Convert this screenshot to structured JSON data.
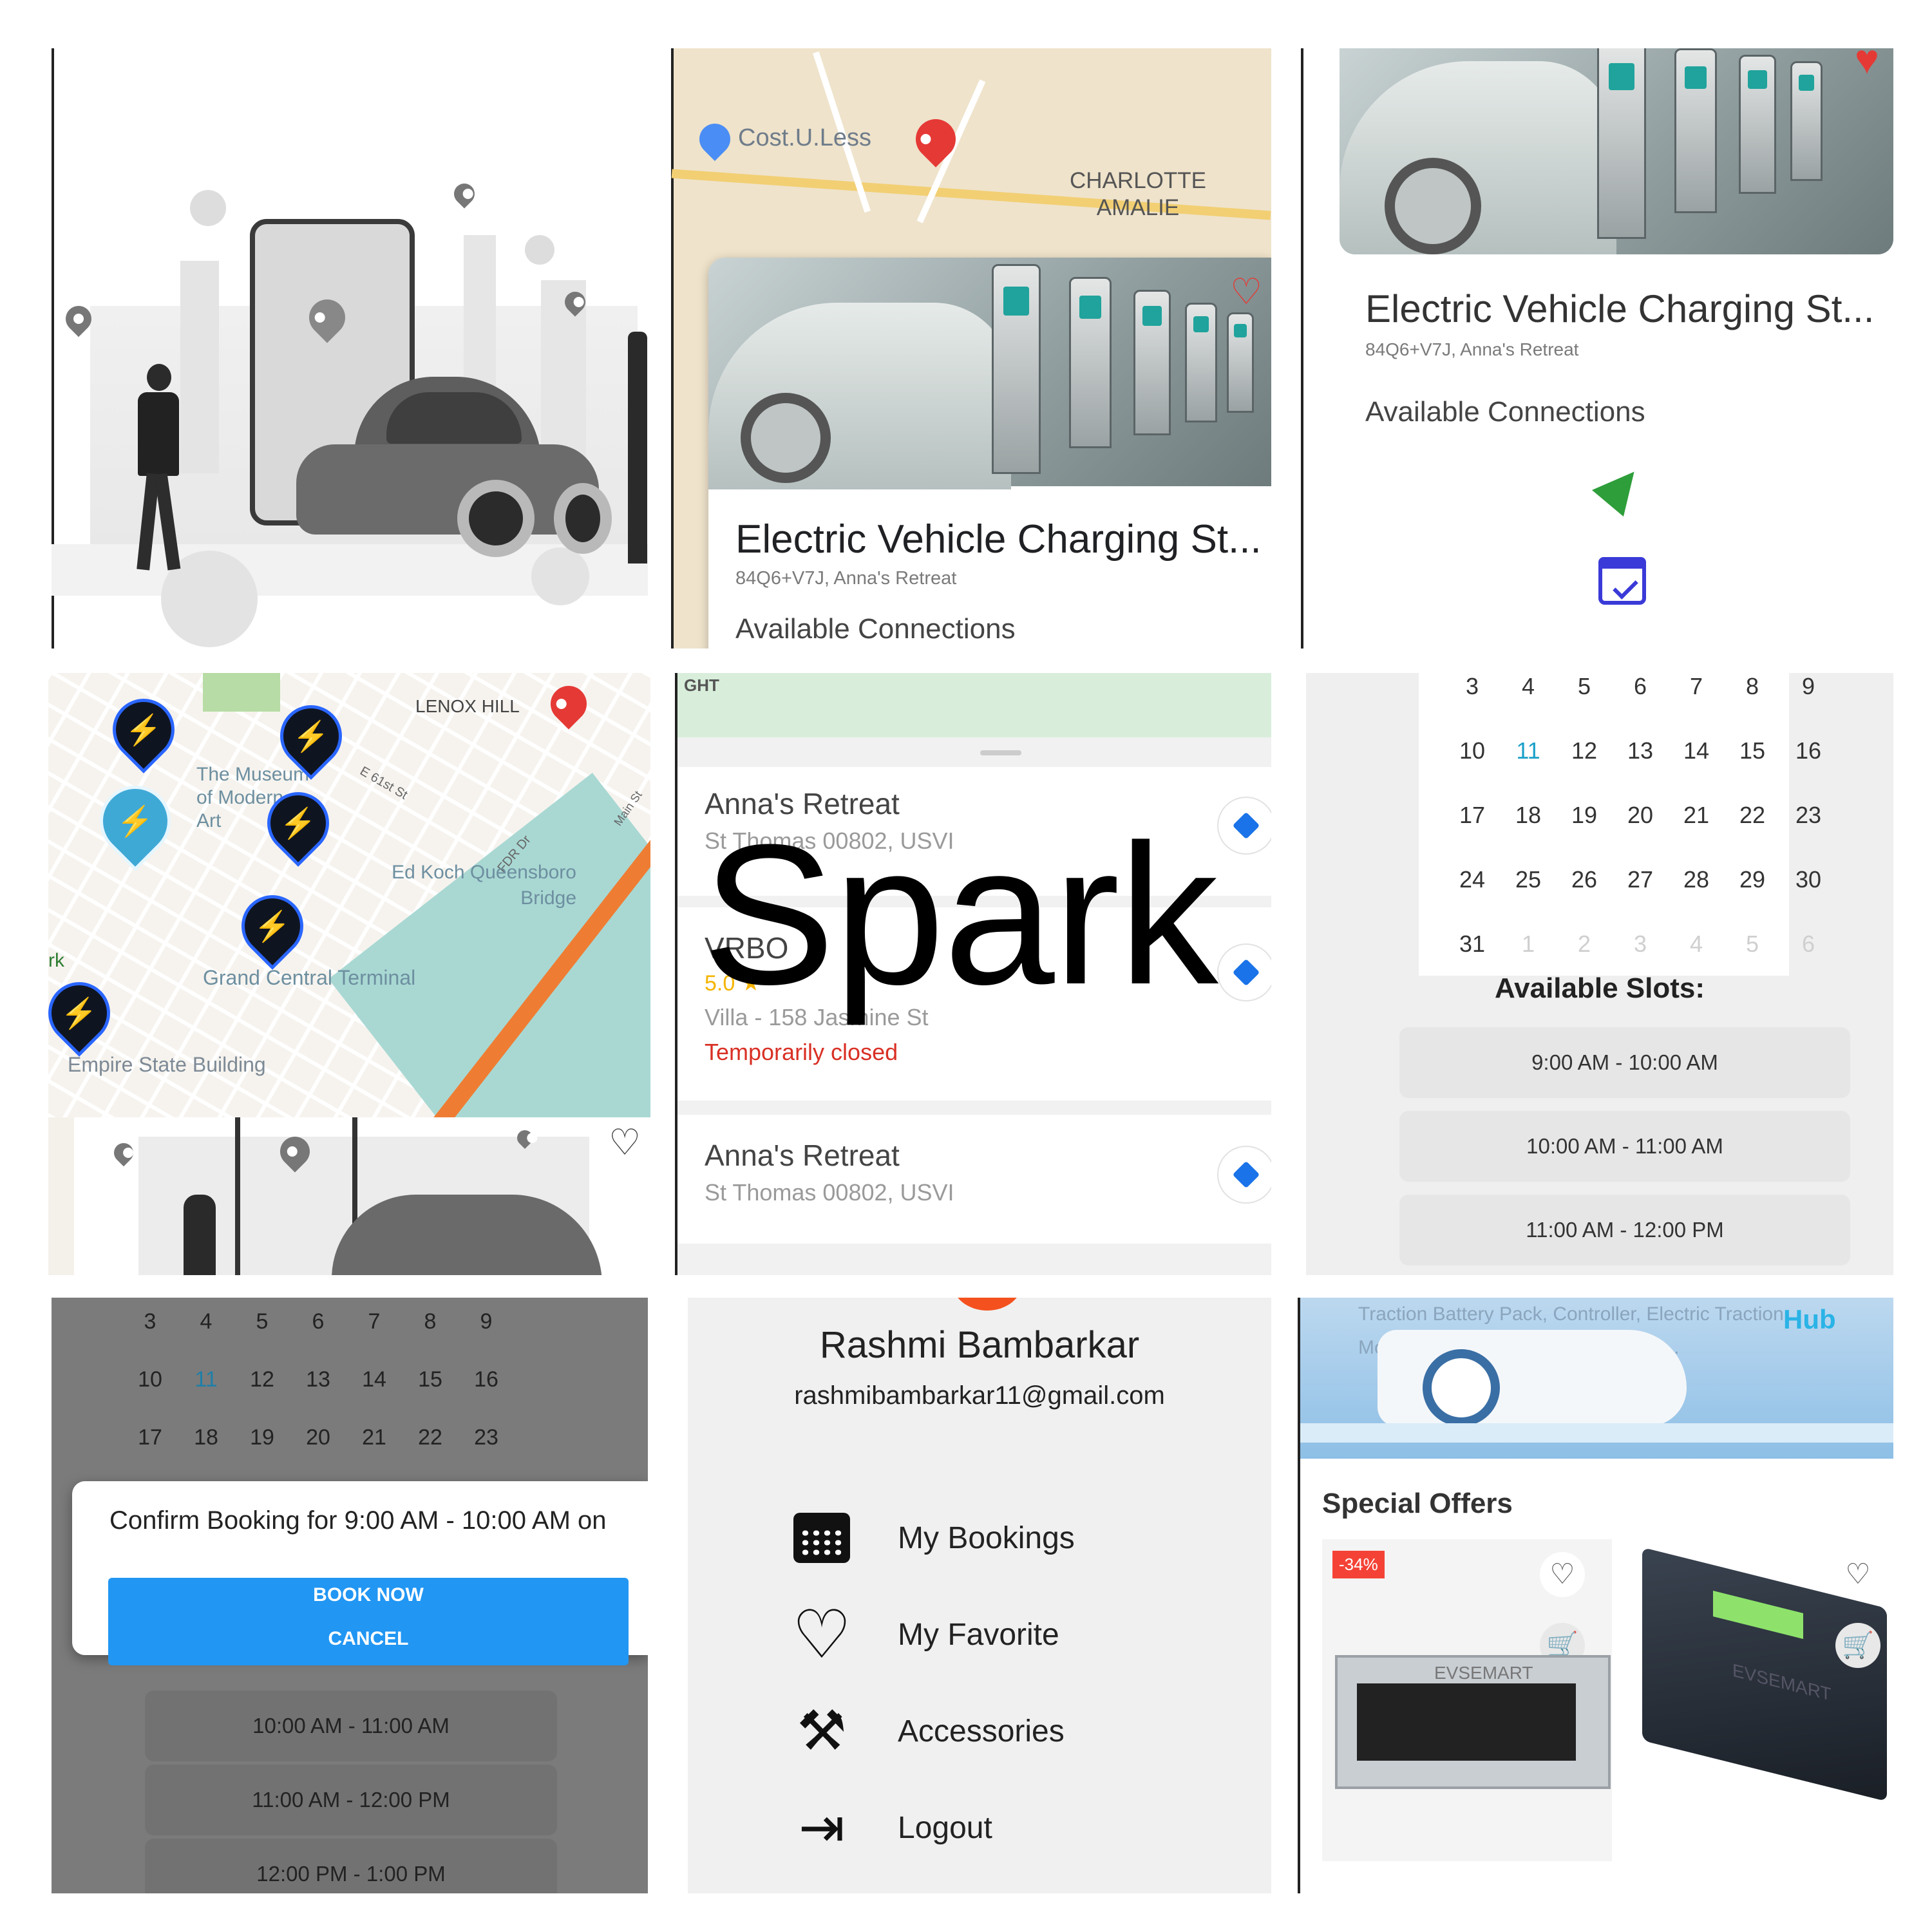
{
  "app_title": "Spark",
  "colors": {
    "accent_blue": "#2196F3",
    "map_pin_red": "#e53935",
    "closed_red": "#d93025",
    "offer_badge": "#f44336",
    "cal_today": "#1aa0c8"
  },
  "station_card": {
    "title": "Electric Vehicle Charging St...",
    "address": "84Q6+V7J, Anna's Retreat",
    "connections_label": "Available Connections",
    "connections_label_cut": "Available Connections"
  },
  "map1": {
    "poi_store": "Cost.U.Less",
    "area_label": "CHARLOTTE AMALIE"
  },
  "map2": {
    "area_label": "LENOX HILL",
    "museum_label": "The Museum of Modern Art",
    "street1": "E 61st St",
    "bridge_label": "Ed Koch Queensboro Bridge",
    "terminal_label": "Grand Central Terminal",
    "empire_label": "Empire State Building",
    "park_label": "rk",
    "fdr_label": "FDR Dr",
    "main_label": "Main St"
  },
  "list": {
    "top_label": "GHT",
    "items": [
      {
        "name": "Anna's Retreat",
        "address": "St Thomas 00802, USVI"
      },
      {
        "name": "VRBO",
        "address": "Villa - 158 Jasmine St",
        "status": "Temporarily closed",
        "rating": "5.0 ★"
      },
      {
        "name": "Anna's Retreat",
        "address": "St Thomas 00802, USVI"
      }
    ]
  },
  "calendar": {
    "rows": [
      [
        "3",
        "4",
        "5",
        "6",
        "7",
        "8",
        "9"
      ],
      [
        "10",
        "11",
        "12",
        "13",
        "14",
        "15",
        "16"
      ],
      [
        "17",
        "18",
        "19",
        "20",
        "21",
        "22",
        "23"
      ],
      [
        "24",
        "25",
        "26",
        "27",
        "28",
        "29",
        "30"
      ],
      [
        "31",
        "1",
        "2",
        "3",
        "4",
        "5",
        "6"
      ]
    ],
    "today": "11",
    "slots_title": "Available Slots:",
    "slots": [
      "9:00 AM - 10:00 AM",
      "10:00 AM - 11:00 AM",
      "11:00 AM - 12:00 PM"
    ]
  },
  "booking": {
    "rows": [
      [
        "3",
        "4",
        "5",
        "6",
        "7",
        "8",
        "9"
      ],
      [
        "10",
        "11",
        "12",
        "13",
        "14",
        "15",
        "16"
      ],
      [
        "17",
        "18",
        "19",
        "20",
        "21",
        "22",
        "23"
      ]
    ],
    "dialog_text": "Confirm Booking for 9:00 AM - 10:00 AM on",
    "book_now": "BOOK NOW",
    "cancel": "CANCEL",
    "slots": [
      "10:00 AM - 11:00 AM",
      "11:00 AM - 12:00 PM",
      "12:00 PM - 1:00 PM"
    ]
  },
  "profile": {
    "name": "Rashmi Bambarkar",
    "email": "rashmibambarkar11@gmail.com",
    "menu": [
      {
        "label": "My Bookings",
        "icon": "calendar-icon"
      },
      {
        "label": "My Favorite",
        "icon": "heart-icon"
      },
      {
        "label": "Accessories",
        "icon": "tools-icon"
      },
      {
        "label": "Logout",
        "icon": "logout-icon"
      }
    ]
  },
  "shop": {
    "banner_text": "Traction Battery Pack, Controller, Electric Traction Motor, EV Charger and many more ...",
    "banner_brand": "Hub",
    "section_title": "Special Offers",
    "badge": "-34%",
    "product_brand": "EVSEMART"
  }
}
